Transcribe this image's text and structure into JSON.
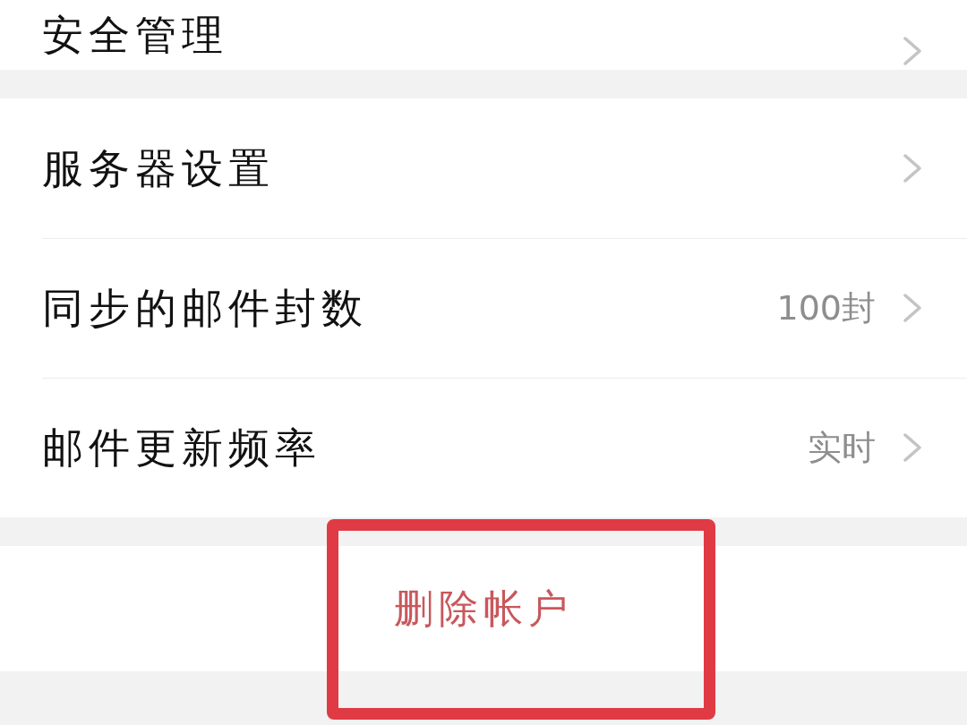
{
  "top_item": {
    "label": "安全管理"
  },
  "settings": [
    {
      "label": "服务器设置"
    },
    {
      "label": "同步的邮件封数",
      "value": "100封"
    },
    {
      "label": "邮件更新频率",
      "value": "实时"
    }
  ],
  "delete_button": {
    "label": "删除帐户"
  }
}
